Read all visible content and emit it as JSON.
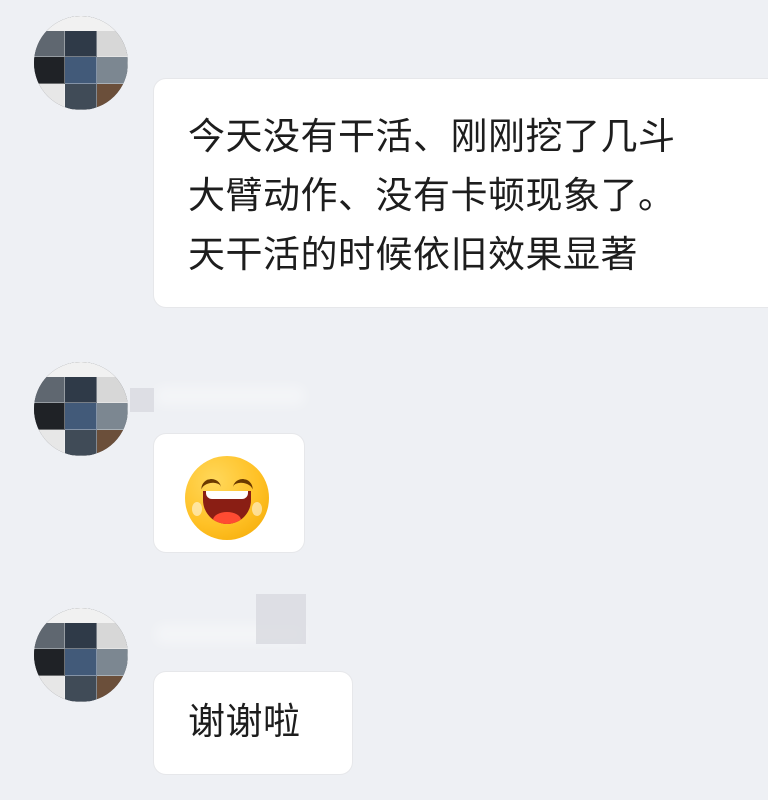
{
  "conversation": {
    "messages": [
      {
        "type": "text",
        "text": "今天没有干活、刚刚挖了几斗\n大臂动作、没有卡顿现象了。\n天干活的时候依旧效果显著"
      },
      {
        "type": "emoji",
        "emoji": "laughing-face"
      },
      {
        "type": "text",
        "text": "谢谢啦"
      }
    ]
  },
  "colors": {
    "background": "#eef0f4",
    "bubble": "#ffffff",
    "text": "#1d1d1d"
  }
}
